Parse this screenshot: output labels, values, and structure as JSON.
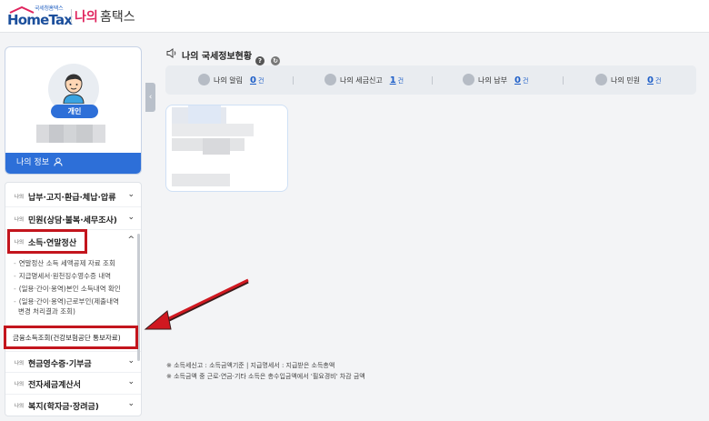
{
  "header": {
    "logo_sub": "국세청홈택스",
    "logo_main": "HomeTax",
    "logo_na": "나의",
    "logo_home": "홈택스"
  },
  "profile": {
    "badge": "개인",
    "my_info_label": "나의 정보"
  },
  "menu": {
    "items": [
      {
        "small": "나의",
        "label": "납부·고지·환급·체납·압류",
        "chev": "⌄"
      },
      {
        "small": "나의",
        "label": "민원(상담·불복·세무조사)",
        "chev": "⌄"
      },
      {
        "small": "나의",
        "label": "소득·연말정산",
        "chev": "^"
      },
      {
        "small": "나의",
        "label": "현금영수증·기부금",
        "chev": "⌄"
      },
      {
        "small": "나의",
        "label": "전자세금계산서",
        "chev": "⌄"
      },
      {
        "small": "나의",
        "label": "복지(학자금·장려금)",
        "chev": "⌄"
      }
    ],
    "sub_items": [
      "연말정산 소득 세액공제 자료 조회",
      "지급명세서·원천징수영수증 내역",
      "(일용·간이·용역)본인 소득내역 확인",
      "(일용·간이·용역)근로부인(제출내역",
      "변경 처리결과 조회)"
    ],
    "highlighted_sub": "금융소득조회(건강보험공단 통보자료)"
  },
  "main": {
    "title": "나의 국세정보현황",
    "stats": [
      {
        "label": "나의 알림",
        "value": "0",
        "unit": "건"
      },
      {
        "label": "나의 세금신고",
        "value": "1",
        "unit": "건"
      },
      {
        "label": "나의 납부",
        "value": "0",
        "unit": "건"
      },
      {
        "label": "나의 민원",
        "value": "0",
        "unit": "건"
      }
    ],
    "notes": [
      "※ 소득세신고 : 소득금액기준  |  지급명세서 : 지급받은 소득총액",
      "※ 소득금액 중 근로·연금·기타 소득은 총수입금액에서 '필요경비' 차감 금액"
    ]
  },
  "colors": {
    "accent": "#2d6fd8",
    "highlight": "#c3151d",
    "brand_pink": "#e0245e"
  }
}
